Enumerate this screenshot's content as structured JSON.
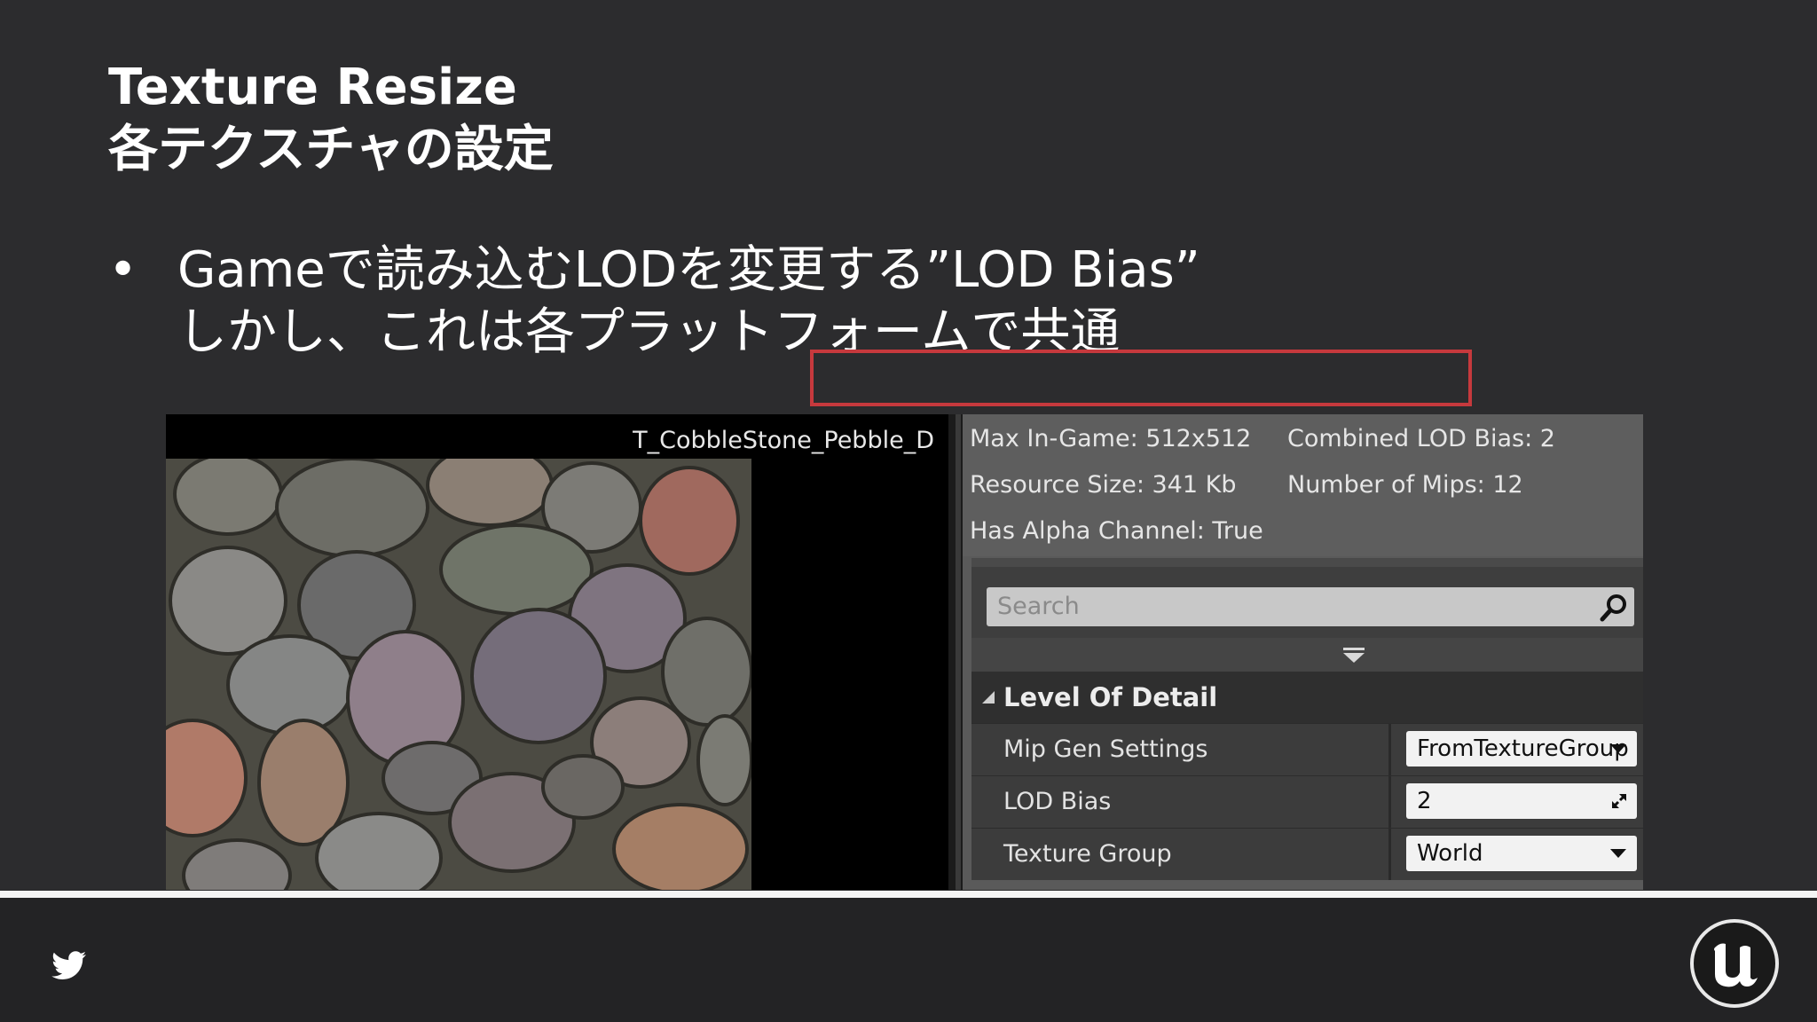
{
  "slide": {
    "title_line1": "Texture Resize",
    "title_line2": "各テクスチャの設定",
    "bullet_symbol": "•",
    "bullet_line1": "Gameで読み込むLODを変更する”LOD Bias”",
    "bullet_line2": "しかし、これは各プラットフォームで共通"
  },
  "editor": {
    "asset_name": "T_CobbleStone_Pebble_D",
    "info": {
      "max_in_game": "Max In-Game: 512x512",
      "combined_lod_bias": "Combined LOD Bias: 2",
      "resource_size": "Resource Size: 341 Kb",
      "number_of_mips": "Number of Mips: 12",
      "has_alpha": "Has Alpha Channel: True"
    },
    "search": {
      "placeholder": "Search"
    },
    "section_title": "Level Of Detail",
    "properties": [
      {
        "label": "Mip Gen Settings",
        "value": "FromTextureGroup",
        "control": "dropdown"
      },
      {
        "label": "LOD Bias",
        "value": "2",
        "control": "spinbox"
      },
      {
        "label": "Texture Group",
        "value": "World",
        "control": "dropdown"
      }
    ],
    "highlight_color": "#c6393d"
  },
  "footer": {
    "icons": [
      "twitter-icon",
      "unreal-engine-logo"
    ]
  }
}
